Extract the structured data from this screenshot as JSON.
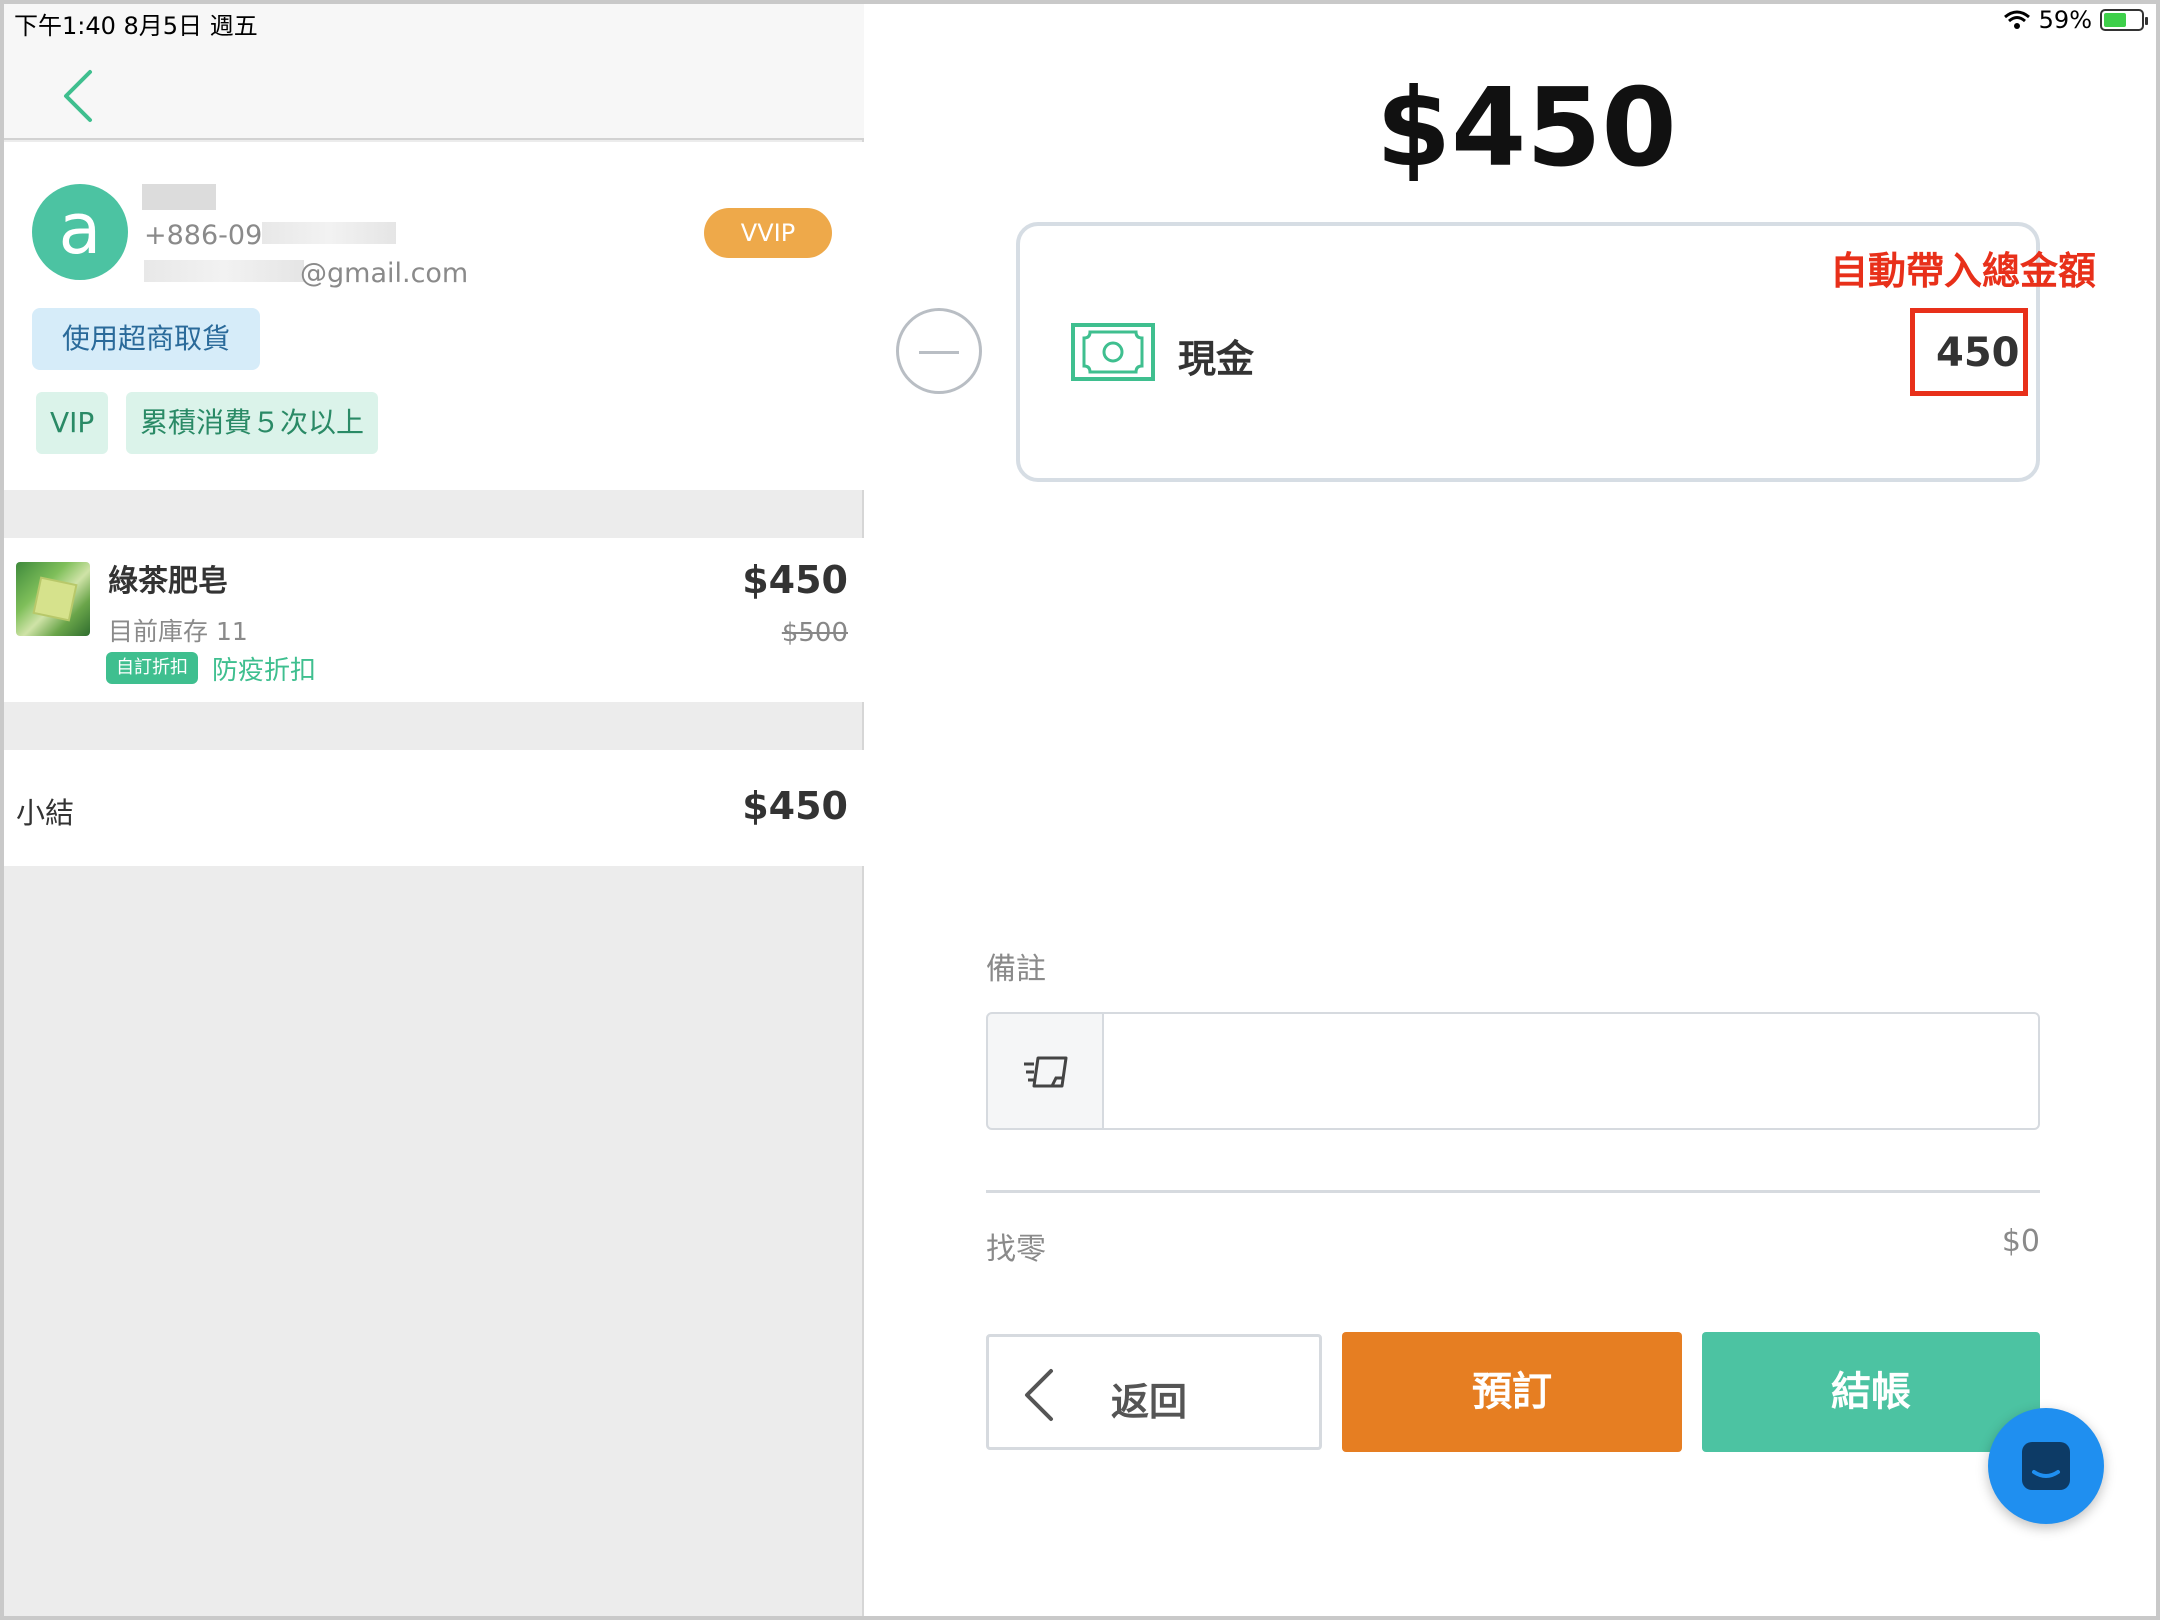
{
  "status_bar": {
    "time_date": "下午1:40   8月5日 週五",
    "battery": "59%",
    "battery_level": 0.59
  },
  "customer": {
    "avatar_letter": "a",
    "phone_prefix": "+886-09",
    "email_suffix": "@gmail.com",
    "tier_badge": "VVIP",
    "pickup_tag": "使用超商取貨",
    "tags": [
      "VIP",
      "累積消費５次以上"
    ]
  },
  "cart": {
    "items": [
      {
        "name": "綠茶肥皂",
        "stock": "目前庫存 11",
        "discount_badge": "自訂折扣",
        "discount_label": "防疫折扣",
        "price": "$450",
        "original_price": "$500"
      }
    ],
    "subtotal_label": "小結",
    "subtotal_value": "$450"
  },
  "payment": {
    "total": "$450",
    "method_label": "現金",
    "method_icon": "cash-icon",
    "amount": "450",
    "annotation": "自動帶入總金額"
  },
  "note": {
    "label": "備註",
    "value": "",
    "icon": "note-icon"
  },
  "change": {
    "label": "找零",
    "value": "$0"
  },
  "actions": {
    "back": "返回",
    "reserve": "預訂",
    "checkout": "結帳"
  },
  "colors": {
    "accent_green": "#4cc3a2",
    "reserve_orange": "#e67e22",
    "vvip_orange": "#eea94a",
    "annotation_red": "#e8301a",
    "chat_blue": "#1f8ff0"
  }
}
